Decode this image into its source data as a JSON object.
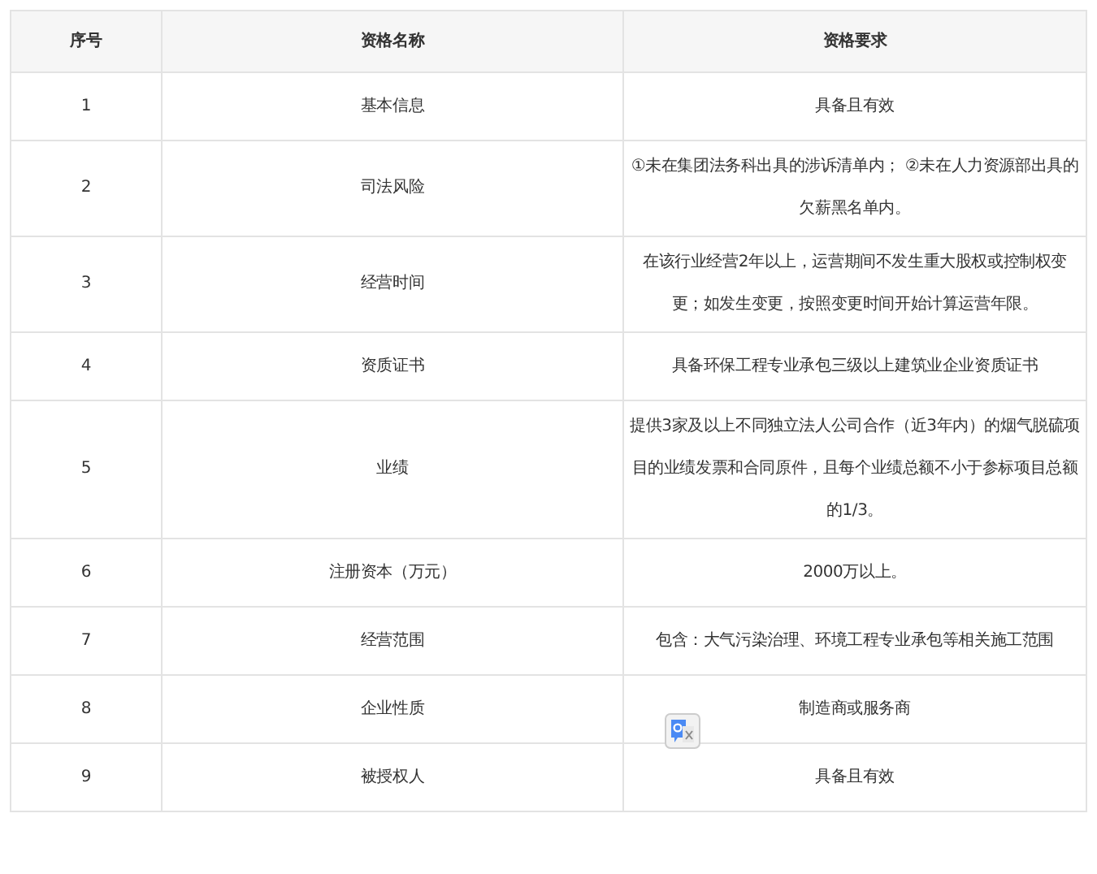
{
  "table": {
    "columns": [
      "序号",
      "资格名称",
      "资格要求"
    ],
    "rows": [
      [
        "1",
        "基本信息",
        "具备且有效"
      ],
      [
        "2",
        "司法风险",
        "①未在集团法务科出具的涉诉清单内； ②未在人力资源部出具的欠薪黑名单内。"
      ],
      [
        "3",
        "经营时间",
        "在该行业经营2年以上，运营期间不发生重大股权或控制权变更；如发生变更，按照变更时间开始计算运营年限。"
      ],
      [
        "4",
        "资质证书",
        "具备环保工程专业承包三级以上建筑业企业资质证书"
      ],
      [
        "5",
        "业绩",
        "提供3家及以上不同独立法人公司合作（近3年内）的烟气脱硫项目的业绩发票和合同原件，且每个业绩总额不小于参标项目总额的1/3。"
      ],
      [
        "6",
        "注册资本（万元）",
        "2000万以上。"
      ],
      [
        "7",
        "经营范围",
        "包含：大气污染治理、环境工程专业承包等相关施工范围"
      ],
      [
        "8",
        "企业性质",
        "制造商或服务商"
      ],
      [
        "9",
        "被授权人",
        "具备且有效"
      ]
    ]
  }
}
